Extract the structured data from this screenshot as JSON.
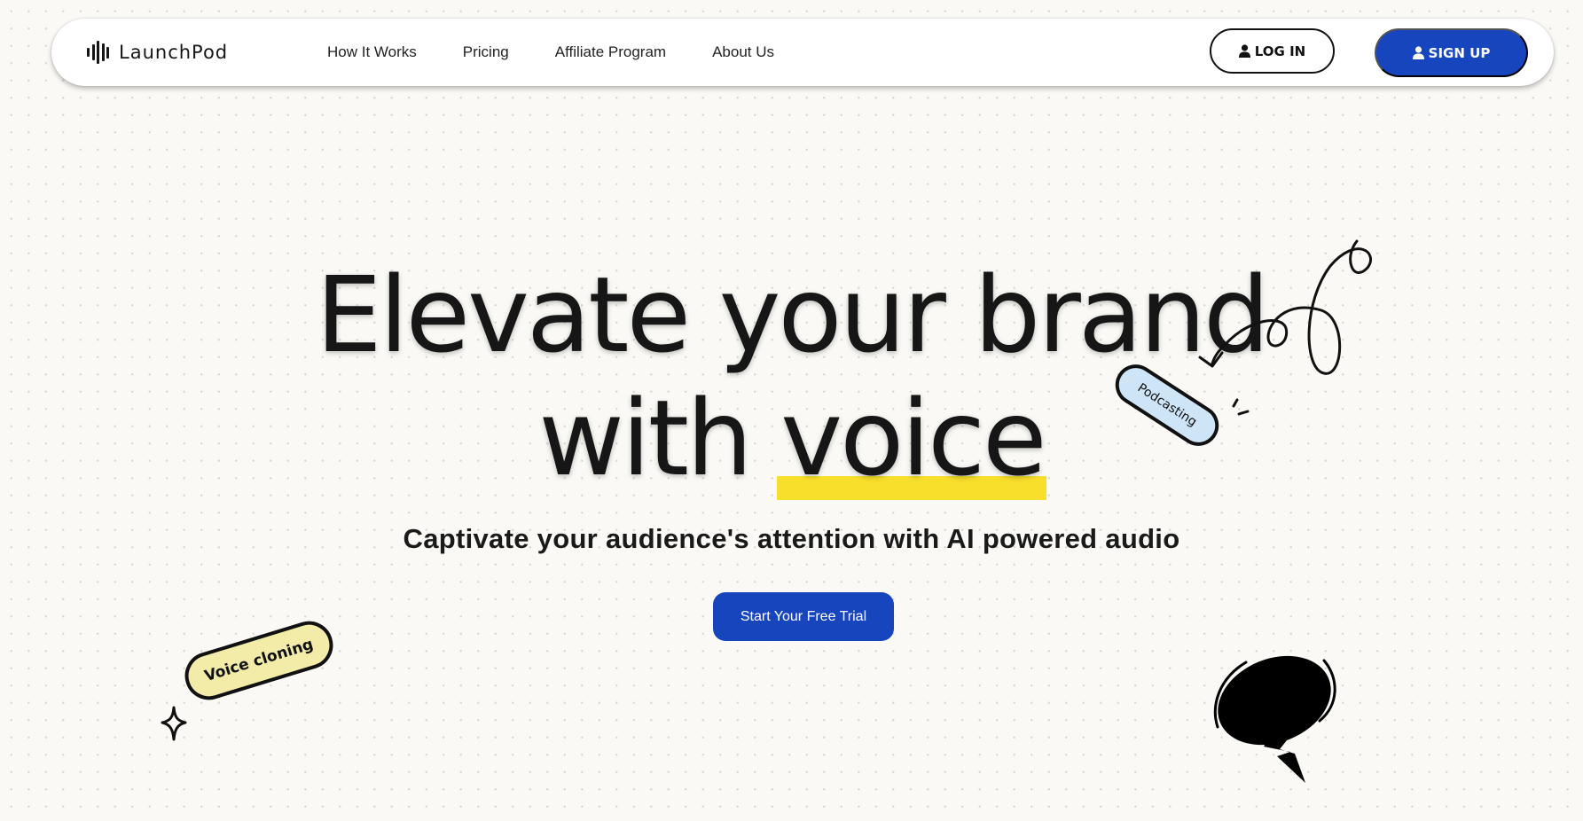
{
  "nav": {
    "brand": "LaunchPod",
    "links": [
      {
        "label": "How It Works"
      },
      {
        "label": "Pricing"
      },
      {
        "label": "Affiliate Program"
      },
      {
        "label": "About Us"
      }
    ],
    "login_label": "LOG IN",
    "signup_label": "SIGN UP",
    "icons": {
      "logo": "waveform-icon",
      "user": "user-icon"
    }
  },
  "hero": {
    "headline_line1": "Elevate your brand",
    "headline_line2_prefix": "with ",
    "headline_highlight": "voice",
    "subtitle": "Captivate your audience's attention with AI powered audio",
    "cta_label": "Start Your Free Trial"
  },
  "stickers": {
    "podcasting": "Podcasting",
    "voice_cloning": "Voice cloning"
  },
  "colors": {
    "brand_blue": "#1745be",
    "highlight_yellow": "#f7df2c",
    "sticker_blue": "#cde5f6",
    "sticker_yellow": "#f2eca8",
    "background": "#faf9f5"
  }
}
